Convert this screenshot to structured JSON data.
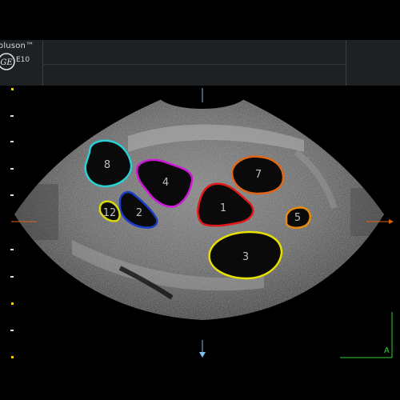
{
  "header": {
    "brand": "oluson™",
    "model": "E10",
    "logo_icon": "ge-monogram-icon"
  },
  "image": {
    "modality": "transvaginal ultrasound",
    "follicles": [
      {
        "label": "1",
        "color": "#e01818"
      },
      {
        "label": "2",
        "color": "#1a3cc8"
      },
      {
        "label": "3",
        "color": "#e8e000"
      },
      {
        "label": "4",
        "color": "#d016d8"
      },
      {
        "label": "5",
        "color": "#e88a10"
      },
      {
        "label": "7",
        "color": "#e0661a"
      },
      {
        "label": "8",
        "color": "#2ad0d6"
      },
      {
        "label": "12",
        "color": "#d8d810"
      }
    ]
  },
  "markers": {
    "focus_color": "#e06010",
    "center_line_color": "#7ac0ee",
    "orientation_label": "A",
    "orientation_color": "#2fd33a"
  }
}
